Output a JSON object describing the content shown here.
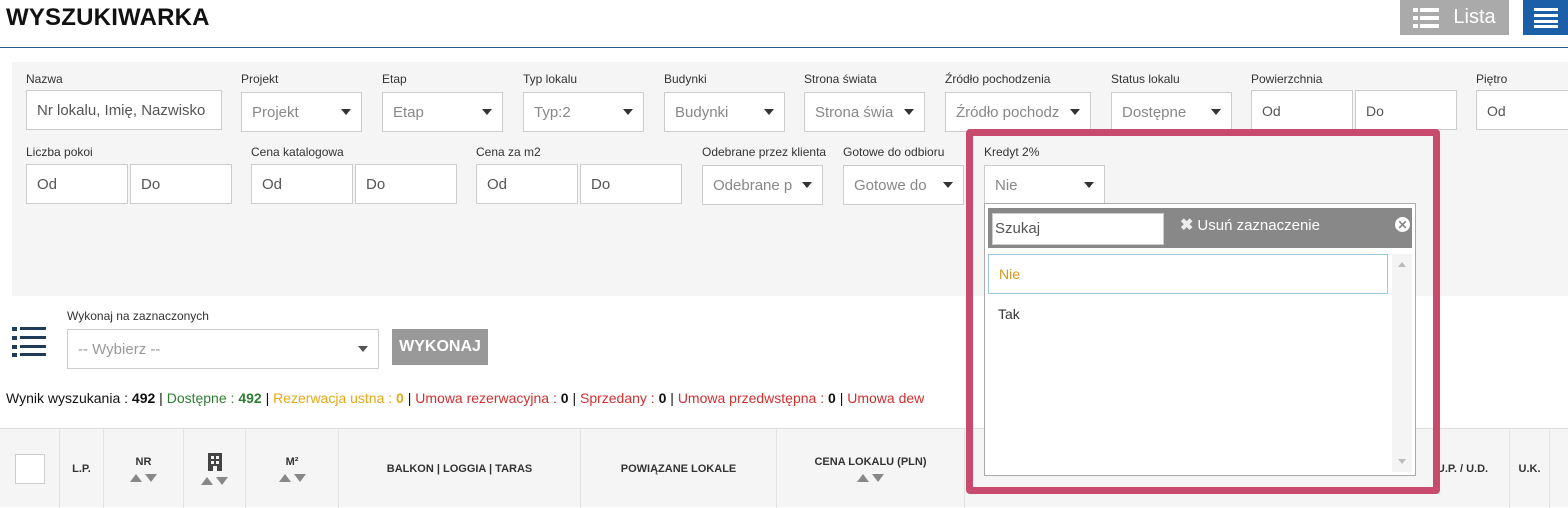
{
  "header": {
    "title": "WYSZUKIWARKA",
    "lista_label": "Lista"
  },
  "filters": {
    "nazwa": {
      "label": "Nazwa",
      "placeholder": "Nr lokalu, Imię, Nazwisko"
    },
    "projekt": {
      "label": "Projekt",
      "value": "Projekt"
    },
    "etap": {
      "label": "Etap",
      "value": "Etap"
    },
    "typ_lokalu": {
      "label": "Typ lokalu",
      "value": "Typ:2"
    },
    "budynki": {
      "label": "Budynki",
      "value": "Budynki"
    },
    "strona_swiata": {
      "label": "Strona świata",
      "value": "Strona świa"
    },
    "zrodlo": {
      "label": "Źródło pochodzenia",
      "value": "Źródło pochodz"
    },
    "status": {
      "label": "Status lokalu",
      "value": "Dostępne"
    },
    "powierzchnia": {
      "label": "Powierzchnia",
      "from": "Od",
      "to": "Do"
    },
    "pietro": {
      "label": "Piętro",
      "from": "Od"
    },
    "liczba_pokoi": {
      "label": "Liczba pokoi",
      "from": "Od",
      "to": "Do"
    },
    "cena_katalogowa": {
      "label": "Cena katalogowa",
      "from": "Od",
      "to": "Do"
    },
    "cena_m2": {
      "label": "Cena za m2",
      "from": "Od",
      "to": "Do"
    },
    "odebrane": {
      "label": "Odebrane przez klienta",
      "value": "Odebrane p"
    },
    "gotowe": {
      "label": "Gotowe do odbioru",
      "value": "Gotowe do"
    },
    "kredyt": {
      "label": "Kredyt 2%",
      "value": "Nie"
    }
  },
  "dropdown": {
    "search_placeholder": "Szukaj",
    "clear_label": "Usuń zaznaczenie",
    "options": [
      "Nie",
      "Tak"
    ],
    "selected": "Nie"
  },
  "bulk": {
    "label": "Wykonaj na zaznaczonych",
    "placeholder": "-- Wybierz --",
    "button": "WYKONAJ"
  },
  "summary": {
    "items": [
      {
        "label": "Wynik wyszukania",
        "value": "492",
        "color": "#111111"
      },
      {
        "label": "Dostępne",
        "value": "492",
        "color": "#2e7d32"
      },
      {
        "label": "Rezerwacja ustna",
        "value": "0",
        "color": "#e6a817"
      },
      {
        "label": "Umowa rezerwacyjna",
        "value": "0",
        "color": "#d32f2f"
      },
      {
        "label": "Sprzedany",
        "value": "0",
        "color": "#d32f2f"
      },
      {
        "label": "Umowa przedwstępna",
        "value": "0",
        "color": "#d32f2f"
      },
      {
        "label": "Umowa dew",
        "value": "",
        "color": "#d32f2f"
      }
    ]
  },
  "table": {
    "headers": {
      "lp": "L.P.",
      "nr": "NR",
      "m2": "M²",
      "balkon": "BALKON | LOGGIA | TARAS",
      "powiazane": "POWIĄZANE LOKALE",
      "cena": "CENA LOKALU (PLN)",
      "up_ud": "U.P. / U.D.",
      "uk": "U.K."
    }
  },
  "colors": {
    "accent_blue": "#1a5fa8",
    "highlight_border": "#c84b6e",
    "header_line": "#2a5a8a"
  }
}
